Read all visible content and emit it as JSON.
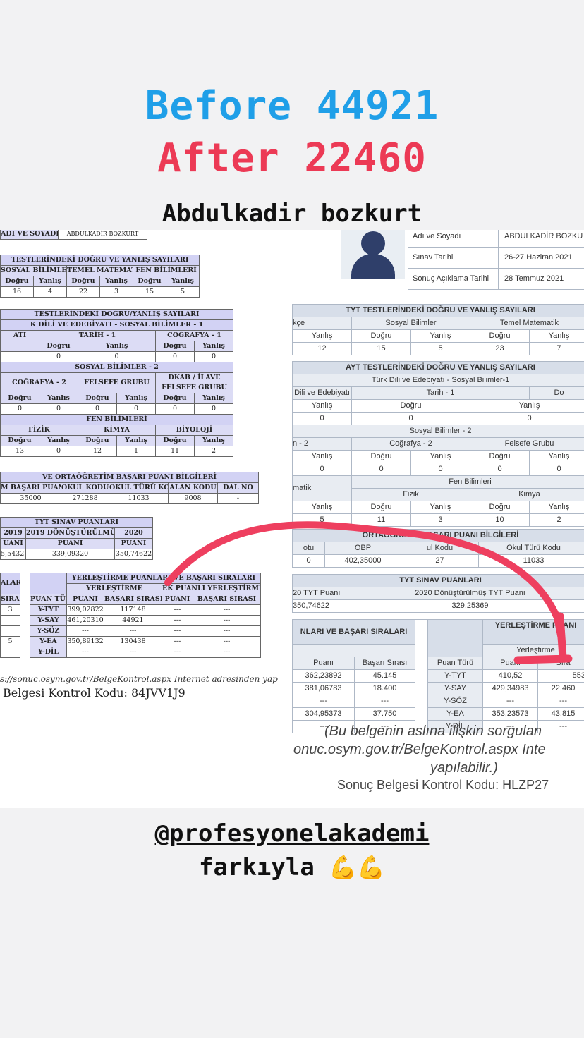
{
  "header": {
    "before": "Before 44921",
    "after": "After 22460",
    "name": "Abdulkadir bozkurt"
  },
  "colors": {
    "before": "#1f9fe8",
    "after": "#ec3a55",
    "arrow": "#ee3f5f"
  },
  "left_doc": {
    "name_label": "ADI VE SOYADI",
    "name_value": "ABDULKADİR BOZKURT",
    "tyt_title": "TESTLERİNDEKİ DOĞRU VE YANLIŞ SAYILARI",
    "tyt_groups": [
      "SOSYAL BİLİMLER",
      "TEMEL MATEMATİK",
      "FEN BİLİMLERİ"
    ],
    "dy": [
      "Doğru",
      "Yanlış"
    ],
    "tyt_values": [
      "16",
      "4",
      "22",
      "3",
      "15",
      "5"
    ],
    "ayt_title": "TESTLERİNDEKİ DOĞRU/YANLIŞ SAYILARI",
    "ayt_sub1": "K DİLİ VE EDEBİYATI - SOSYAL BİLİMLER - 1",
    "ayt_g1": [
      "ATI",
      "TARİH - 1",
      "COĞRAFYA - 1"
    ],
    "ayt_v1": [
      "0",
      "0",
      "0",
      "0",
      "0"
    ],
    "ayt_sub2": "SOSYAL BİLİMLER - 2",
    "ayt_g2": [
      "COĞRAFYA - 2",
      "FELSEFE GRUBU",
      "DKAB / İLAVE FELSEFE GRUBU"
    ],
    "ayt_v2": [
      "0",
      "0",
      "0",
      "0",
      "0",
      "0"
    ],
    "ayt_sub3": "FEN BİLİMLERİ",
    "ayt_g3": [
      "FİZİK",
      "KİMYA",
      "BİYOLOJİ"
    ],
    "ayt_v3": [
      "13",
      "0",
      "12",
      "1",
      "11",
      "2"
    ],
    "obp_title": "VE ORTAÖĞRETİM BAŞARI PUANI BİLGİLERİ",
    "obp_headers": [
      "M BAŞARI PUANI",
      "OKUL KODU",
      "OKUL TÜRÜ KODU",
      "ALAN KODU",
      "DAL NO"
    ],
    "obp_values": [
      "35000",
      "271288",
      "11033",
      "9008",
      "-"
    ],
    "tyt_score_title": "TYT SINAV PUANLARI",
    "tyt_score_headers": [
      "2019",
      "2019 DÖNÜŞTÜRÜLMÜŞ",
      "2020"
    ],
    "tyt_score_sub": [
      "UANI",
      "PUANI",
      "PUANI"
    ],
    "tyt_score_values": [
      "5,54321",
      "339,09320",
      "350,74622"
    ],
    "place_title": "YERLEŞTİRME PUANLARI VE BAŞARI SIRALARI",
    "place_left": "ALARI",
    "place_sub": [
      "YERLEŞTİRME",
      "EK PUANLI YERLEŞTİRME"
    ],
    "place_headers": [
      "PUAN TÜRÜ",
      "PUANI",
      "BAŞARI SIRASI",
      "PUANI",
      "BAŞARI SIRASI"
    ],
    "place_left_head": "SIRASI",
    "place_rows": [
      {
        "left": "3",
        "type": "Y-TYT",
        "puan": "399,02822",
        "sira": "117148",
        "ek_puan": "---",
        "ek_sira": "---"
      },
      {
        "left": "",
        "type": "Y-SAY",
        "puan": "461,20310",
        "sira": "44921",
        "ek_puan": "---",
        "ek_sira": "---"
      },
      {
        "left": "",
        "type": "Y-SÖZ",
        "puan": "---",
        "sira": "---",
        "ek_puan": "---",
        "ek_sira": "---"
      },
      {
        "left": "5",
        "type": "Y-EA",
        "puan": "350,89132",
        "sira": "130438",
        "ek_puan": "---",
        "ek_sira": "---"
      },
      {
        "left": "",
        "type": "Y-DİL",
        "puan": "---",
        "sira": "---",
        "ek_puan": "---",
        "ek_sira": "---"
      }
    ],
    "url_note": "s://sonuc.osym.gov.tr/BelgeKontrol.aspx Internet adresinden yap",
    "control_code": "Belgesi Kontrol Kodu: 84JVV1J9"
  },
  "right_doc": {
    "info_labels": [
      "Adı ve Soyadı",
      "Sınav Tarihi",
      "Sonuç Açıklama Tarihi"
    ],
    "info_values": [
      "ABDULKADİR BOZKU",
      "26-27 Haziran 2021",
      "28 Temmuz 2021"
    ],
    "tyt_title": "TYT TESTLERİNDEKİ DOĞRU VE YANLIŞ SAYILARI",
    "tyt_groups": [
      "kçe",
      "Sosyal Bilimler",
      "Temel Matematik"
    ],
    "dy": [
      "Doğru",
      "Yanlış"
    ],
    "tyt_values": [
      "12",
      "15",
      "5",
      "23",
      "7"
    ],
    "ayt_title": "AYT TESTLERİNDEKİ DOĞRU VE YANLIŞ SAYILARI",
    "ayt_sub1": "Türk Dili ve Edebiyatı - Sosyal Bilimler-1",
    "ayt_g1": [
      "Dili ve Edebiyatı",
      "Tarih - 1",
      "Do"
    ],
    "ayt_v1": [
      "0",
      "0",
      "0"
    ],
    "ayt_sub2": "Sosyal Bilimler - 2",
    "ayt_g2": [
      "n - 2",
      "Coğrafya - 2",
      "Felsefe Grubu"
    ],
    "ayt_v2": [
      "0",
      "0",
      "0",
      "0",
      "0",
      "0"
    ],
    "ayt_sub3": "Fen Bilimleri",
    "ayt_side3": "matik",
    "ayt_g3": [
      "Fizik",
      "Kimya"
    ],
    "ayt_v3": [
      "5",
      "11",
      "3",
      "10",
      "2"
    ],
    "obp_title": "ORTAÖĞRETİM BAŞARI PUANI BİLGİLERİ",
    "obp_headers": [
      "otu",
      "OBP",
      "ul Kodu",
      "Okul Türü Kodu"
    ],
    "obp_values": [
      "0",
      "402,35000",
      "27",
      "11033"
    ],
    "tyt_score_title": "TYT SINAV PUANLARI",
    "tyt_score_headers": [
      "20 TYT Puanı",
      "2020 Dönüştürülmüş TYT Puanı"
    ],
    "tyt_score_values": [
      "350,74622",
      "329,25369"
    ],
    "place_title": "NLARI VE BAŞARI SIRALARI",
    "place_right_title": "YERLEŞTİRME PUANI",
    "place_right_sub": "Yerleştirme",
    "place_headers": [
      "Puanı",
      "Başarı Sırası",
      "Puan Türü",
      "Puanı",
      "Sıra"
    ],
    "place_rows": [
      {
        "p1": "362,23892",
        "s1": "45.145",
        "type": "Y-TYT",
        "p2": "410,52",
        "s2": "553"
      },
      {
        "p1": "381,06783",
        "s1": "18.400",
        "type": "Y-SAY",
        "p2": "429,34983",
        "s2": "22.460"
      },
      {
        "p1": "---",
        "s1": "---",
        "type": "Y-SÖZ",
        "p2": "---",
        "s2": "---"
      },
      {
        "p1": "304,95373",
        "s1": "37.750",
        "type": "Y-EA",
        "p2": "353,23573",
        "s2": "43.815"
      },
      {
        "p1": "---",
        "s1": "---",
        "type": "Y-DİL",
        "p2": "---",
        "s2": "---"
      }
    ],
    "note1": "(Bu belgenin aslına ilişkin sorgulan",
    "note2": "onuc.osym.gov.tr/BelgeKontrol.aspx Inte",
    "note3": "yapılabilir.)",
    "control_code": "Sonuç Belgesi Kontrol Kodu: HLZP27"
  },
  "footer": {
    "handle": "@profesyonelakademi",
    "caption": "farkıyla",
    "emoji": "💪💪"
  }
}
